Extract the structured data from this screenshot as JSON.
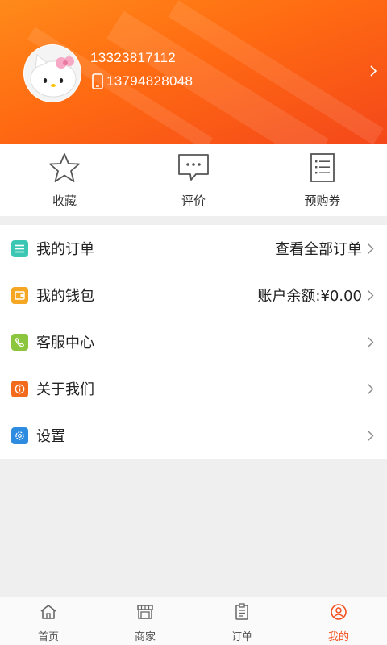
{
  "profile": {
    "phone": "13323817112",
    "mobile": "13794828048",
    "avatar_icon": "hello-kitty-avatar"
  },
  "quick_actions": [
    {
      "label": "收藏",
      "icon": "star-icon"
    },
    {
      "label": "评价",
      "icon": "comment-icon"
    },
    {
      "label": "预购券",
      "icon": "coupon-list-icon"
    }
  ],
  "menu": [
    {
      "label": "我的订单",
      "value": "查看全部订单",
      "icon": "list-icon",
      "color": "#3cc7b5"
    },
    {
      "label": "我的钱包",
      "value": "账户余额:¥0.00",
      "icon": "wallet-icon",
      "color": "#f5a623"
    },
    {
      "label": "客服中心",
      "value": "",
      "icon": "phone-icon",
      "color": "#8cc63f"
    },
    {
      "label": "关于我们",
      "value": "",
      "icon": "info-icon",
      "color": "#f26b1d"
    },
    {
      "label": "设置",
      "value": "",
      "icon": "gear-icon",
      "color": "#2e8ce0"
    }
  ],
  "tabs": [
    {
      "label": "首页",
      "icon": "home-icon",
      "active": false
    },
    {
      "label": "商家",
      "icon": "store-icon",
      "active": false
    },
    {
      "label": "订单",
      "icon": "clipboard-icon",
      "active": false
    },
    {
      "label": "我的",
      "icon": "user-icon",
      "active": true
    }
  ],
  "colors": {
    "header_start": "#ff8a1a",
    "header_end": "#f4471a",
    "active_tab": "#f4511e"
  }
}
